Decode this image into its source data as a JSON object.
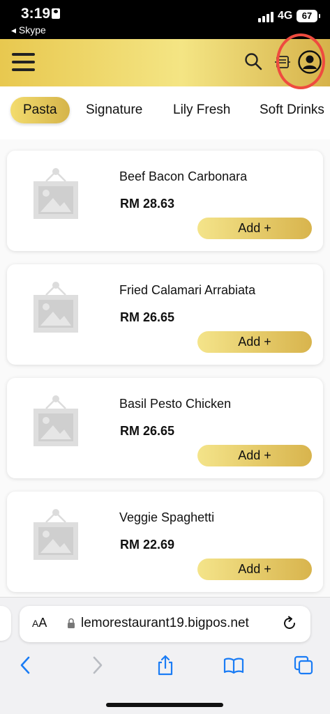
{
  "status_bar": {
    "time": "3:19",
    "back_app": "◂ Skype",
    "network": "4G",
    "battery": "67"
  },
  "header": {
    "menu_icon": "hamburger-icon",
    "search_icon": "search-icon",
    "receipt_icon": "receipt-icon",
    "profile_icon": "user-circle-icon",
    "highlight_color": "#ef4b3f",
    "brand_gradient": [
      "#e8c84f",
      "#f4e584",
      "#d6b24a"
    ]
  },
  "tabs": [
    {
      "label": "Pasta",
      "active": true
    },
    {
      "label": "Signature",
      "active": false
    },
    {
      "label": "Lily Fresh",
      "active": false
    },
    {
      "label": "Soft Drinks",
      "active": false
    }
  ],
  "products": [
    {
      "name": "Beef Bacon Carbonara",
      "price": "RM 28.63",
      "add_label": "Add +"
    },
    {
      "name": "Fried Calamari Arrabiata",
      "price": "RM 26.65",
      "add_label": "Add +"
    },
    {
      "name": "Basil Pesto Chicken",
      "price": "RM 26.65",
      "add_label": "Add +"
    },
    {
      "name": "Veggie Spaghetti",
      "price": "RM 22.69",
      "add_label": "Add +"
    }
  ],
  "browser": {
    "aa_label_small": "A",
    "aa_label_large": "A",
    "url": "lemorestaurant19.bigpos.net",
    "icons": [
      "back-icon",
      "forward-icon",
      "share-icon",
      "bookmarks-icon",
      "tabs-icon"
    ]
  }
}
